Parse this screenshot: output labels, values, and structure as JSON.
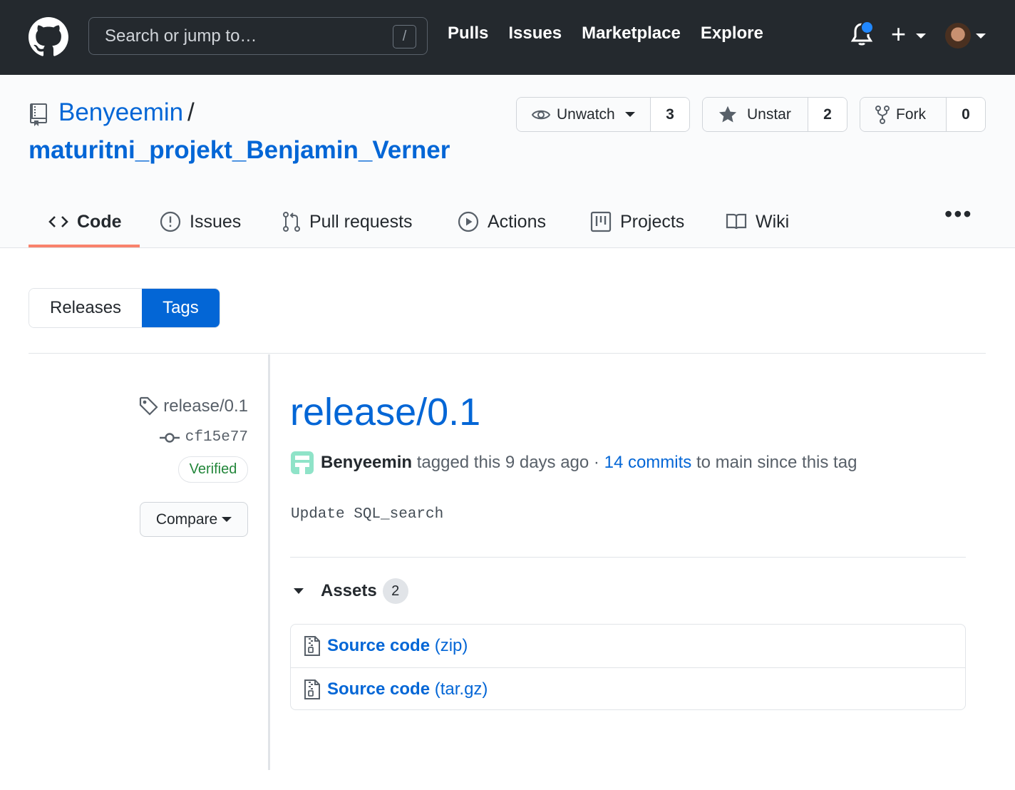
{
  "header": {
    "search_placeholder": "Search or jump to…",
    "search_key": "/",
    "nav": [
      "Pulls",
      "Issues",
      "Marketplace",
      "Explore"
    ],
    "plus": "+",
    "notification_dot_color": "#2188ff"
  },
  "repo": {
    "owner": "Benyeemin",
    "separator": "/",
    "name": "maturitni_projekt_Benjamin_Verner",
    "watch": {
      "label": "Unwatch",
      "count": "3"
    },
    "star": {
      "label": "Unstar",
      "count": "2"
    },
    "fork": {
      "label": "Fork",
      "count": "0"
    }
  },
  "tabs": [
    "Code",
    "Issues",
    "Pull requests",
    "Actions",
    "Projects",
    "Wiki"
  ],
  "tabs_active": "Code",
  "more": "•••",
  "subnav": {
    "releases": "Releases",
    "tags": "Tags",
    "selected": "Tags"
  },
  "release": {
    "tag": "release/0.1",
    "commit": "cf15e77",
    "verified": "Verified",
    "compare": "Compare",
    "title": "release/0.1",
    "author": "Benyeemin",
    "action": "tagged this",
    "time": "9 days ago",
    "dot": "·",
    "commits_link": "14 commits",
    "commits_suffix": "to main since this tag",
    "message": "Update SQL_search",
    "assets_label": "Assets",
    "assets_count": "2",
    "assets": [
      {
        "name": "Source code",
        "ext": "(zip)"
      },
      {
        "name": "Source code",
        "ext": "(tar.gz)"
      }
    ]
  },
  "colors": {
    "header_bg": "#24292e",
    "link": "#0366d6",
    "tab_underline": "#f9826c",
    "verified": "#22863a",
    "selected_tab_bg": "#0366d6"
  }
}
